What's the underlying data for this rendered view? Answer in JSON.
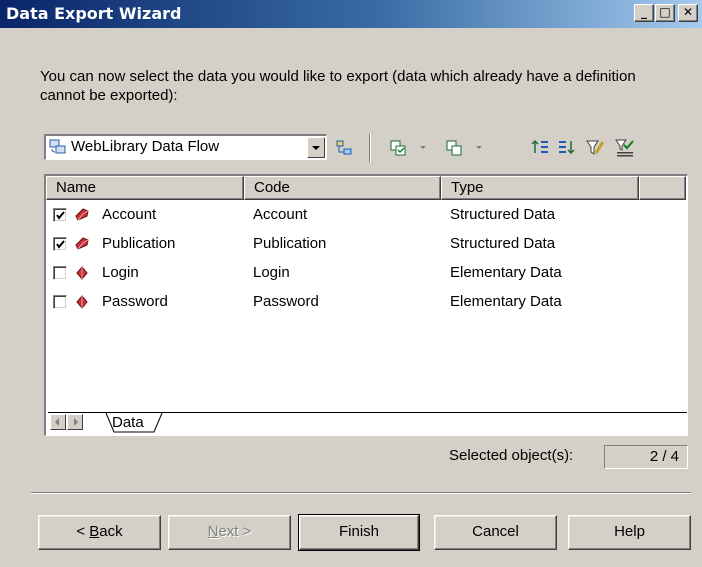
{
  "window": {
    "title": "Data Export Wizard",
    "controls": [
      "_",
      "□",
      "✕"
    ]
  },
  "instructions": "You can now select the data you would like to export (data which already have a definition cannot be exported):",
  "combo": {
    "value": "WebLibrary Data Flow"
  },
  "toolbar_icons": [
    "properties-icon",
    "select-all-icon",
    "deselect-all-icon",
    "move-up-icon",
    "move-down-icon",
    "filter-icon",
    "filter-apply-icon"
  ],
  "list": {
    "columns": [
      "Name",
      "Code",
      "Type"
    ],
    "rows": [
      {
        "checked": true,
        "name": "Account",
        "code": "Account",
        "type": "Structured Data"
      },
      {
        "checked": true,
        "name": "Publication",
        "code": "Publication",
        "type": "Structured Data"
      },
      {
        "checked": false,
        "name": "Login",
        "code": "Login",
        "type": "Elementary Data"
      },
      {
        "checked": false,
        "name": "Password",
        "code": "Password",
        "type": "Elementary Data"
      }
    ],
    "tab": "Data"
  },
  "status": {
    "label": "Selected object(s):",
    "value": "2 / 4"
  },
  "buttons": {
    "back": {
      "pre": "< ",
      "mnemonic": "B",
      "post": "ack"
    },
    "next": {
      "mnemonic": "N",
      "post": "ext >"
    },
    "finish": "Finish",
    "cancel": "Cancel",
    "help": "Help"
  },
  "colors": {
    "title_bar": "#0a246a",
    "face": "#d4d0c8",
    "data_icon": "#c8323c"
  }
}
